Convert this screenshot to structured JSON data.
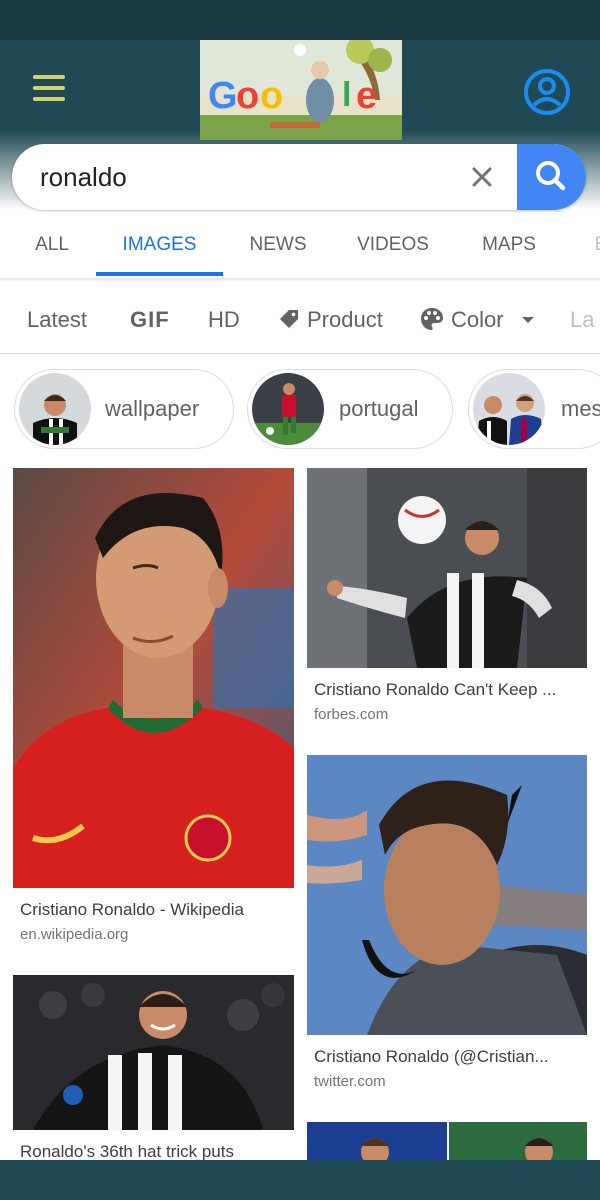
{
  "search": {
    "query": "ronaldo"
  },
  "tabs": [
    {
      "label": "ALL"
    },
    {
      "label": "IMAGES"
    },
    {
      "label": "NEWS"
    },
    {
      "label": "VIDEOS"
    },
    {
      "label": "MAPS"
    },
    {
      "label": "B"
    }
  ],
  "active_tab": "IMAGES",
  "filters": [
    {
      "label": "Latest"
    },
    {
      "label": "GIF"
    },
    {
      "label": "HD"
    },
    {
      "label": "Product",
      "icon": "tag-icon"
    },
    {
      "label": "Color",
      "icon": "palette-icon"
    },
    {
      "label": "La"
    }
  ],
  "chips": [
    {
      "label": "wallpaper"
    },
    {
      "label": "portugal"
    },
    {
      "label": "mes"
    }
  ],
  "results": [
    {
      "title": "Cristiano Ronaldo - Wikipedia",
      "source": "en.wikipedia.org"
    },
    {
      "title": "Cristiano Ronaldo Can't Keep ...",
      "source": "forbes.com"
    },
    {
      "title": "Cristiano Ronaldo (@Cristian...",
      "source": "twitter.com"
    },
    {
      "title": "Ronaldo's 36th hat trick puts",
      "source": ""
    }
  ],
  "colors": {
    "header": "#1f4a55",
    "accent": "#1a73e8",
    "search_button": "#4285f4",
    "menu_icon": "#d7cf6a"
  }
}
